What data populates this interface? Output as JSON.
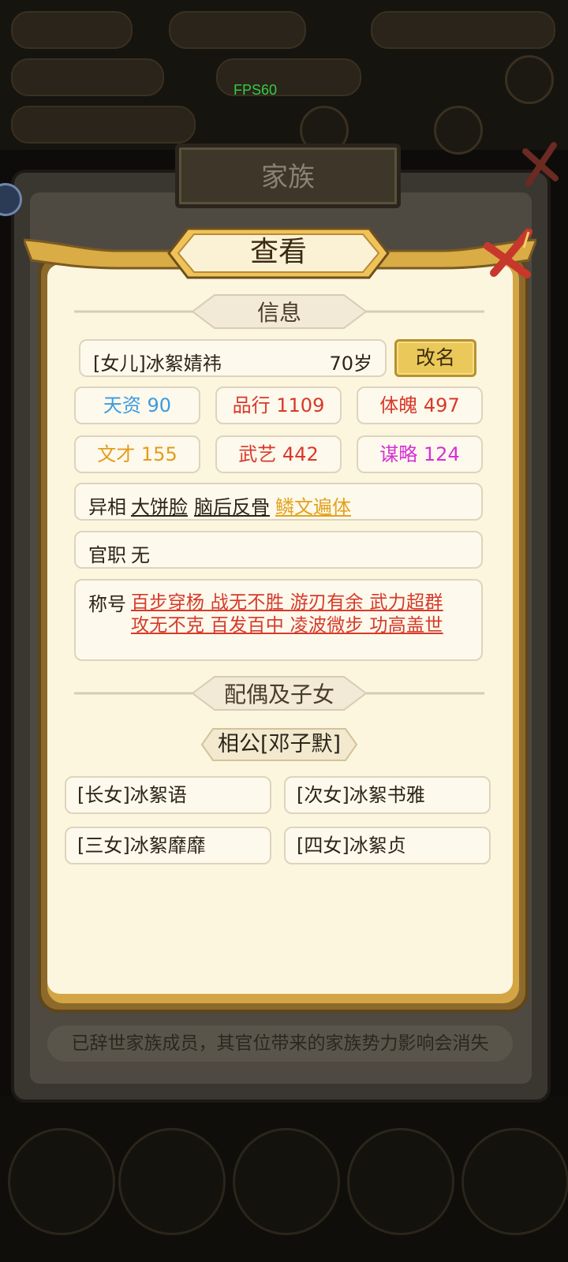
{
  "system": {
    "fps": "FPS60"
  },
  "family_panel": {
    "title": "家族",
    "footer_note": "已辞世家族成员，其官位带来的家族势力影响会消失"
  },
  "dialog": {
    "title": "查看",
    "info_section": "信息",
    "member": {
      "name": "[女儿]冰絮婧祎",
      "age": "70岁"
    },
    "rename_label": "改名",
    "stats": [
      {
        "label": "天资 90",
        "color": "#3b9be0"
      },
      {
        "label": "品行 1109",
        "color": "#d9382a"
      },
      {
        "label": "体魄 497",
        "color": "#d9382a"
      },
      {
        "label": "文才 155",
        "color": "#e39c1c"
      },
      {
        "label": "武艺 442",
        "color": "#d9382a"
      },
      {
        "label": "谋略 124",
        "color": "#d630d6"
      }
    ],
    "appearance": {
      "label": "异相",
      "traits": [
        {
          "text": "大饼脸",
          "color": "#2b2418"
        },
        {
          "text": "脑后反骨",
          "color": "#2b2418"
        },
        {
          "text": "鳞文遍体",
          "color": "#e3a21c"
        }
      ]
    },
    "official": {
      "label": "官职",
      "value": "无"
    },
    "titles": {
      "label": "称号",
      "line1": "百步穿杨 战无不胜 游刃有余 武力超群",
      "line2": "攻无不克 百发百中 凌波微步 功高盖世"
    },
    "family_section": "配偶及子女",
    "spouse": "相公[邓子默]",
    "children": [
      "[长女]冰絮语",
      "[次女]冰絮书雅",
      "[三女]冰絮靡靡",
      "[四女]冰絮贞"
    ]
  },
  "colors": {
    "frame_gold": "#d3a545",
    "parchment": "#fcf6df",
    "close_red": "#c8372b"
  }
}
